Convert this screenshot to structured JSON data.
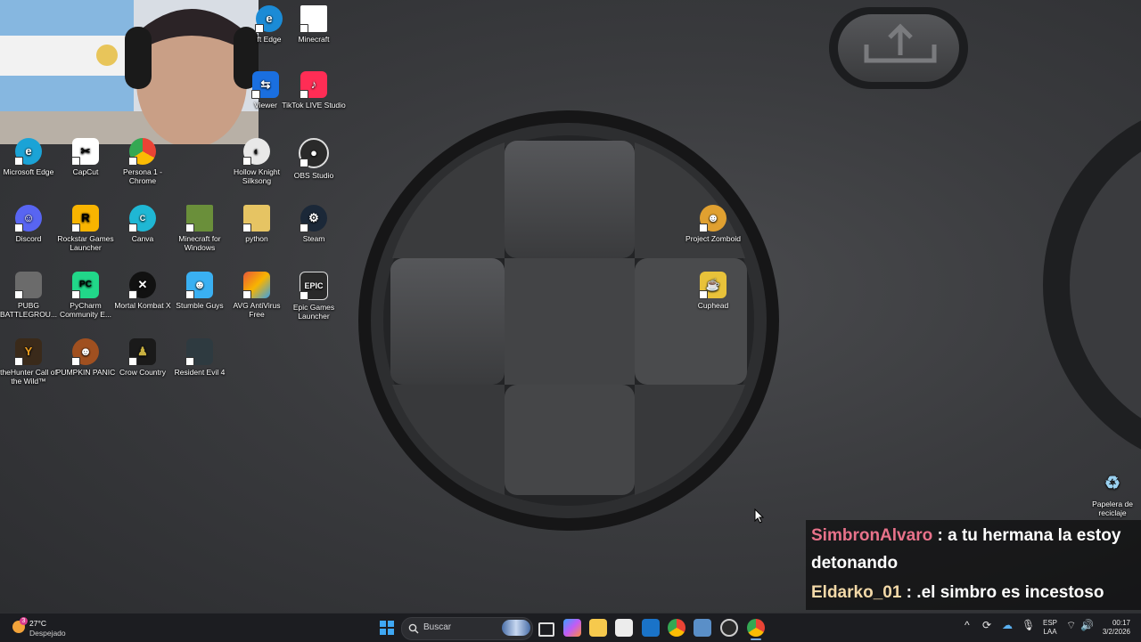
{
  "desktop_icons": [
    {
      "label": "ft Edge",
      "color": "#1b8bd6"
    },
    {
      "label": "Minecraft",
      "color": "#ffffff"
    },
    {
      "label": "Viewer",
      "color": "#1a6fe0"
    },
    {
      "label": "TikTok LIVE Studio",
      "color": "#ff2d55"
    },
    {
      "label": "Microsoft Edge",
      "color": "#1ba3d6"
    },
    {
      "label": "CapCut",
      "color": "#ffffff"
    },
    {
      "label": "Persona 1 - Chrome",
      "color": "#e0a12a"
    },
    {
      "label": "Hollow Knight Silksong",
      "color": "#e8e8e8"
    },
    {
      "label": "OBS Studio",
      "color": "#2a2a2a"
    },
    {
      "label": "Discord",
      "color": "#5865f2"
    },
    {
      "label": "Rockstar Games Launcher",
      "color": "#f8b400"
    },
    {
      "label": "Canva",
      "color": "#1fb7d4"
    },
    {
      "label": "Minecraft for Windows",
      "color": "#6a8f3a"
    },
    {
      "label": "python",
      "color": "#e6c463"
    },
    {
      "label": "Steam",
      "color": "#1b2838"
    },
    {
      "label": "PUBG BATTLEGROU...",
      "color": "#6b6b6b"
    },
    {
      "label": "PyCharm Community E...",
      "color": "#21d789"
    },
    {
      "label": "Mortal Kombat X",
      "color": "#111111"
    },
    {
      "label": "Stumble Guys",
      "color": "#3ab0f2"
    },
    {
      "label": "AVG AntiVirus Free",
      "color": "#e8573a"
    },
    {
      "label": "Epic Games Launcher",
      "color": "#2a2a2a"
    },
    {
      "label": "theHunter Call of the Wild™",
      "color": "#f0a020"
    },
    {
      "label": "PUMPKIN PANIC",
      "color": "#a05020"
    },
    {
      "label": "Crow Country",
      "color": "#c8b040"
    },
    {
      "label": "Resident Evil 4",
      "color": "#2e3a40"
    },
    {
      "label": "Project Zomboid",
      "color": "#e0a030"
    },
    {
      "label": "Cuphead",
      "color": "#e8c23a"
    },
    {
      "label": "Papelera de reciclaje",
      "color": "#9ad1f0"
    }
  ],
  "chat": [
    {
      "user": "SimbronAlvaro",
      "sep": " : ",
      "text": "a tu hermana la estoy detonando"
    },
    {
      "user": "Eldarko_01",
      "sep": " : ",
      "text": ".el simbro es incestoso"
    }
  ],
  "taskbar": {
    "weather_temp": "27°C",
    "weather_desc": "Despejado",
    "weather_badge": "3",
    "search_placeholder": "Buscar",
    "lang_line1": "ESP",
    "lang_line2": "LAA",
    "time": "00:17",
    "date": "3/2/2026",
    "pinned_icons": [
      "start-icon",
      "search-icon",
      "task-view-icon",
      "copilot-icon",
      "file-explorer-icon",
      "store-icon",
      "outlook-icon",
      "chrome-icon",
      "app-icon",
      "obs-icon",
      "chrome-icon-2"
    ],
    "tray_icons": [
      "chevron-up-icon",
      "sync-icon",
      "network-icon",
      "microphone-icon",
      "wifi-icon",
      "volume-icon"
    ]
  }
}
